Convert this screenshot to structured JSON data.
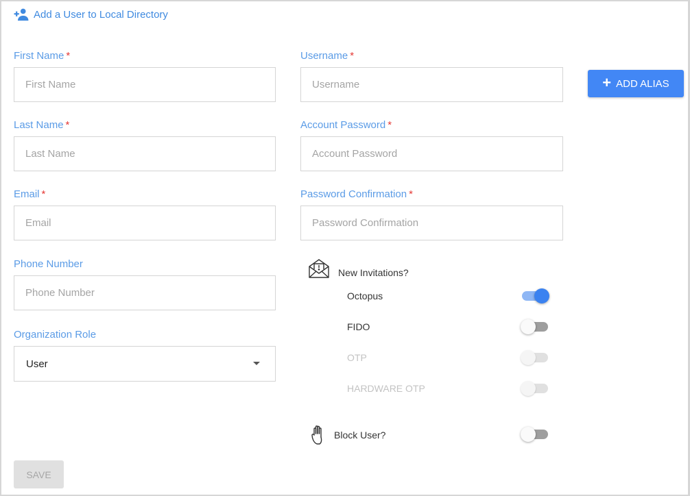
{
  "header": {
    "title": "Add a User to Local Directory",
    "icon": "person-add-icon"
  },
  "fields": {
    "first_name": {
      "label": "First Name",
      "required": "*",
      "placeholder": "First Name",
      "value": ""
    },
    "last_name": {
      "label": "Last Name",
      "required": "*",
      "placeholder": "Last Name",
      "value": ""
    },
    "email": {
      "label": "Email",
      "required": "*",
      "placeholder": "Email",
      "value": ""
    },
    "phone": {
      "label": "Phone Number",
      "placeholder": "Phone Number",
      "value": ""
    },
    "org_role": {
      "label": "Organization Role",
      "selected": "User"
    },
    "username": {
      "label": "Username",
      "required": "*",
      "placeholder": "Username",
      "value": ""
    },
    "password": {
      "label": "Account Password",
      "required": "*",
      "placeholder": "Account Password",
      "value": ""
    },
    "password_confirm": {
      "label": "Password Confirmation",
      "required": "*",
      "placeholder": "Password Confirmation",
      "value": ""
    }
  },
  "add_alias_button": {
    "label": "ADD ALIAS"
  },
  "invitations": {
    "title": "New Invitations?",
    "icon": "mail-alert-icon",
    "options": [
      {
        "label": "Octopus",
        "on": true,
        "disabled": false
      },
      {
        "label": "FIDO",
        "on": false,
        "disabled": false
      },
      {
        "label": "OTP",
        "on": false,
        "disabled": true
      },
      {
        "label": "HARDWARE OTP",
        "on": false,
        "disabled": true
      }
    ]
  },
  "block_user": {
    "label": "Block User?",
    "icon": "hand-stop-icon",
    "on": false
  },
  "save_button": {
    "label": "SAVE"
  },
  "colors": {
    "accent": "#4287f5",
    "label": "#5a9be6",
    "required": "#e53935",
    "border": "#d4d4d4"
  }
}
